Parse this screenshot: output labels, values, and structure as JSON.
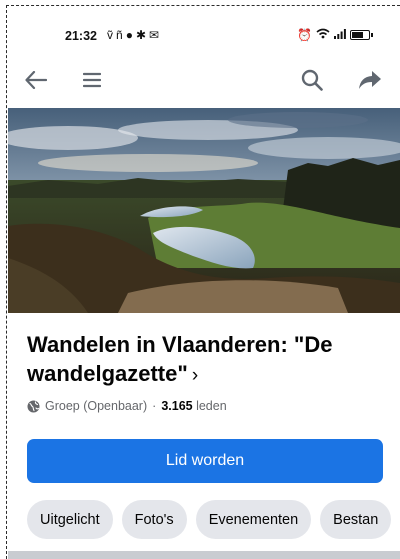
{
  "status_bar": {
    "time": "21:32",
    "left_icons": [
      "vpn-icon",
      "facebook-icon",
      "bug-icon",
      "mail-icon"
    ],
    "right_icons": [
      "alarm-icon",
      "wifi-icon",
      "signal-icon",
      "battery-icon"
    ]
  },
  "topbar": {
    "back_icon": "arrow-left-icon",
    "menu_icon": "hamburger-icon",
    "search_icon": "search-icon",
    "share_icon": "share-icon"
  },
  "group": {
    "title": "Wandelen in Vlaanderen: \"De wandelgazette\"",
    "chevron": "›",
    "privacy": "Groep (Openbaar)",
    "separator": "·",
    "member_count": "3.165",
    "members_label": "leden"
  },
  "join_button": {
    "label": "Lid worden"
  },
  "tabs": [
    "Uitgelicht",
    "Foto's",
    "Evenementen",
    "Bestan"
  ],
  "colors": {
    "primary": "#1b74e4",
    "chip_bg": "#e4e6eb",
    "secondary_text": "#65676b"
  }
}
